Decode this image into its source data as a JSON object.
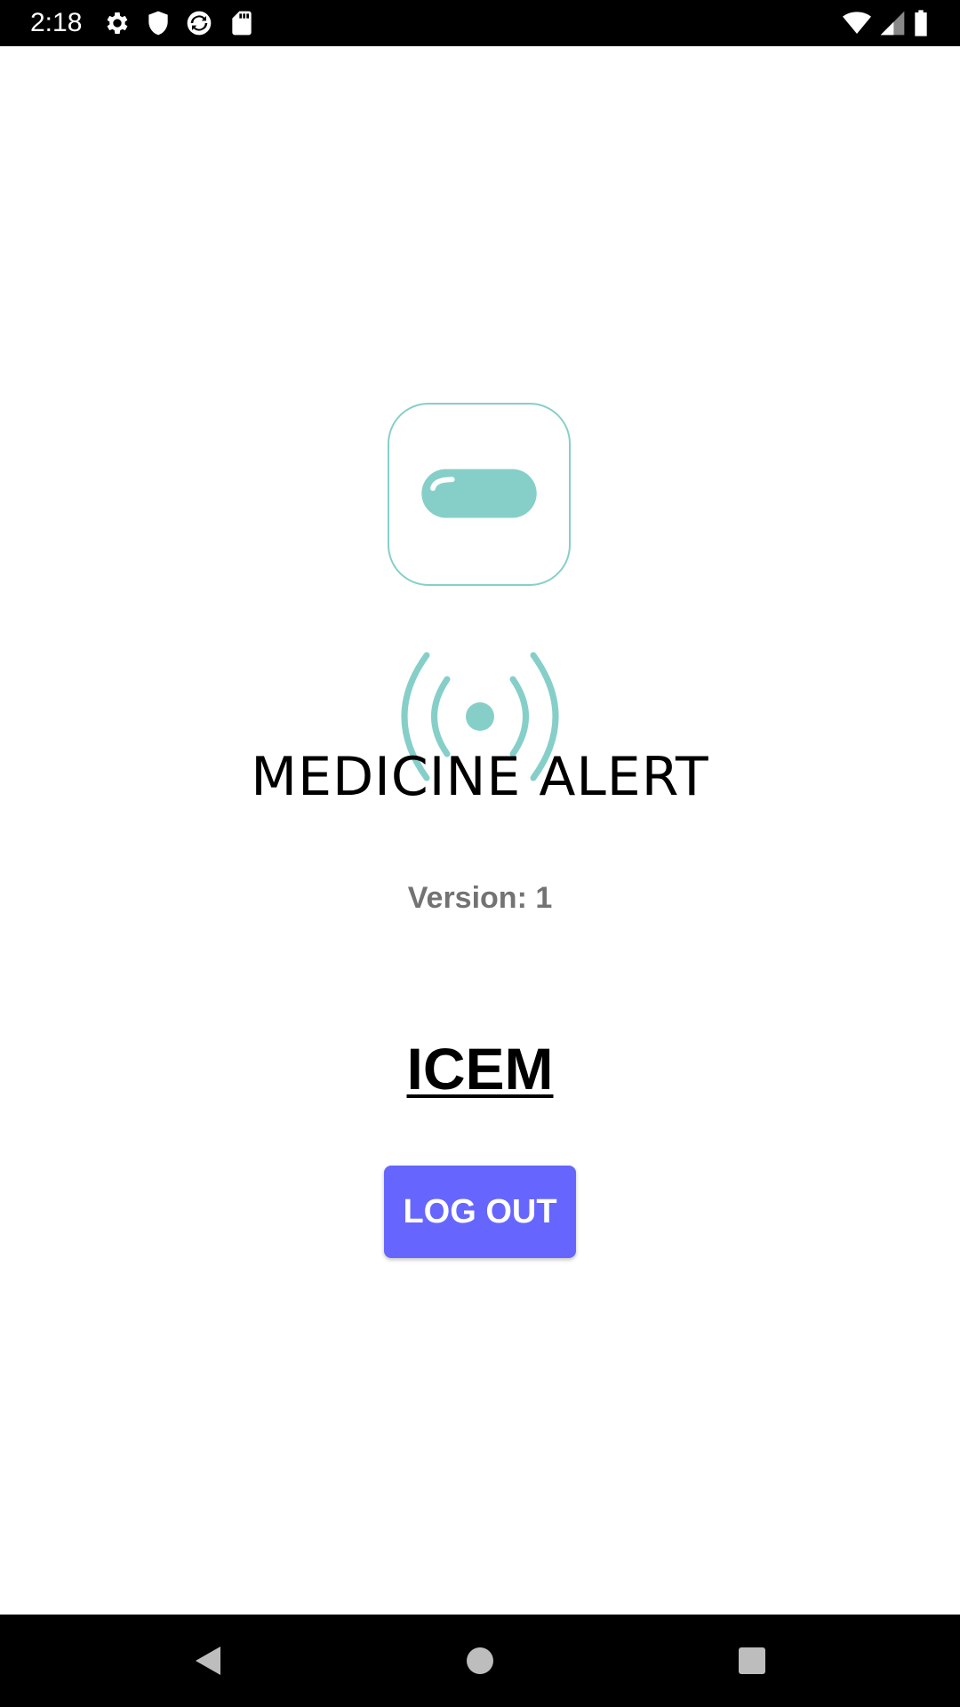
{
  "status_bar": {
    "time": "2:18",
    "left_icons": [
      "gear-icon",
      "shield-icon",
      "sync-icon",
      "sd-card-icon"
    ],
    "right_icons": [
      "wifi-icon",
      "cell-signal-icon",
      "battery-icon"
    ]
  },
  "app": {
    "title": "MEDICINE ALERT",
    "version_label": "Version:",
    "version_value": "1",
    "version_text": "Version: 1",
    "user_name": "ICEM",
    "logout_label": "LOG OUT",
    "logo_icon": "pill-icon",
    "broadcast_icon": "broadcast-signal-icon"
  },
  "colors": {
    "accent_teal": "#86cfc9",
    "button": "#6666ff",
    "version_text": "#737373",
    "bars": "#000000"
  },
  "nav_bar": {
    "buttons": [
      "back-icon",
      "home-icon",
      "recents-icon"
    ]
  }
}
